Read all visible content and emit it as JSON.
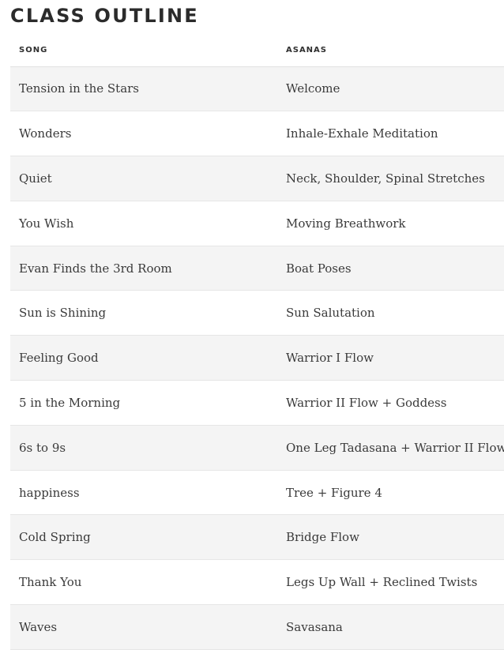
{
  "title": "CLASS OUTLINE",
  "table": {
    "headers": [
      "SONG",
      "ASANAS"
    ],
    "rows": [
      {
        "song": "Tension in the Stars",
        "asana": "Welcome"
      },
      {
        "song": "Wonders",
        "asana": "Inhale-Exhale Meditation"
      },
      {
        "song": "Quiet",
        "asana": "Neck, Shoulder, Spinal Stretches"
      },
      {
        "song": "You Wish",
        "asana": "Moving Breathwork"
      },
      {
        "song": "Evan Finds the 3rd Room",
        "asana": "Boat Poses"
      },
      {
        "song": "Sun is Shining",
        "asana": "Sun Salutation"
      },
      {
        "song": "Feeling Good",
        "asana": "Warrior I Flow"
      },
      {
        "song": "5 in the Morning",
        "asana": "Warrior II Flow + Goddess"
      },
      {
        "song": "6s to 9s",
        "asana": "One Leg Tadasana + Warrior II Flow"
      },
      {
        "song": "happiness",
        "asana": "Tree + Figure 4"
      },
      {
        "song": "Cold Spring",
        "asana": "Bridge Flow"
      },
      {
        "song": "Thank You",
        "asana": "Legs Up Wall + Reclined Twists"
      },
      {
        "song": "Waves",
        "asana": "Savasana"
      }
    ]
  }
}
